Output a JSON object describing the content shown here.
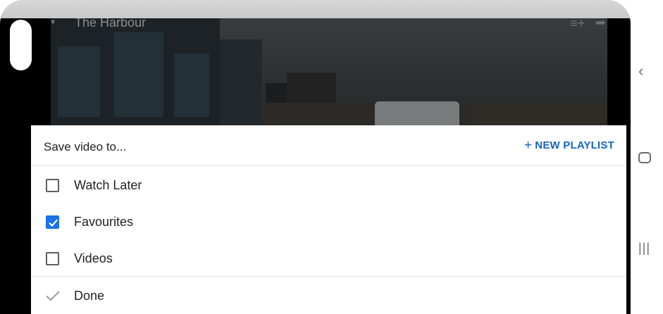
{
  "video": {
    "title": "The Harbour",
    "queue_icon": "add-to-queue-icon",
    "share_icon": "share-icon"
  },
  "sheet": {
    "title": "Save video to...",
    "new_playlist": "NEW PLAYLIST",
    "options": [
      {
        "label": "Watch Later",
        "checked": false
      },
      {
        "label": "Favourites",
        "checked": true
      },
      {
        "label": "Videos",
        "checked": false
      }
    ],
    "done": "Done"
  },
  "colors": {
    "accent": "#1565c0",
    "checkbox_checked": "#1a73e8"
  },
  "nav": {
    "back_icon": "back-icon",
    "home_icon": "home-icon",
    "recents_icon": "recents-icon"
  }
}
